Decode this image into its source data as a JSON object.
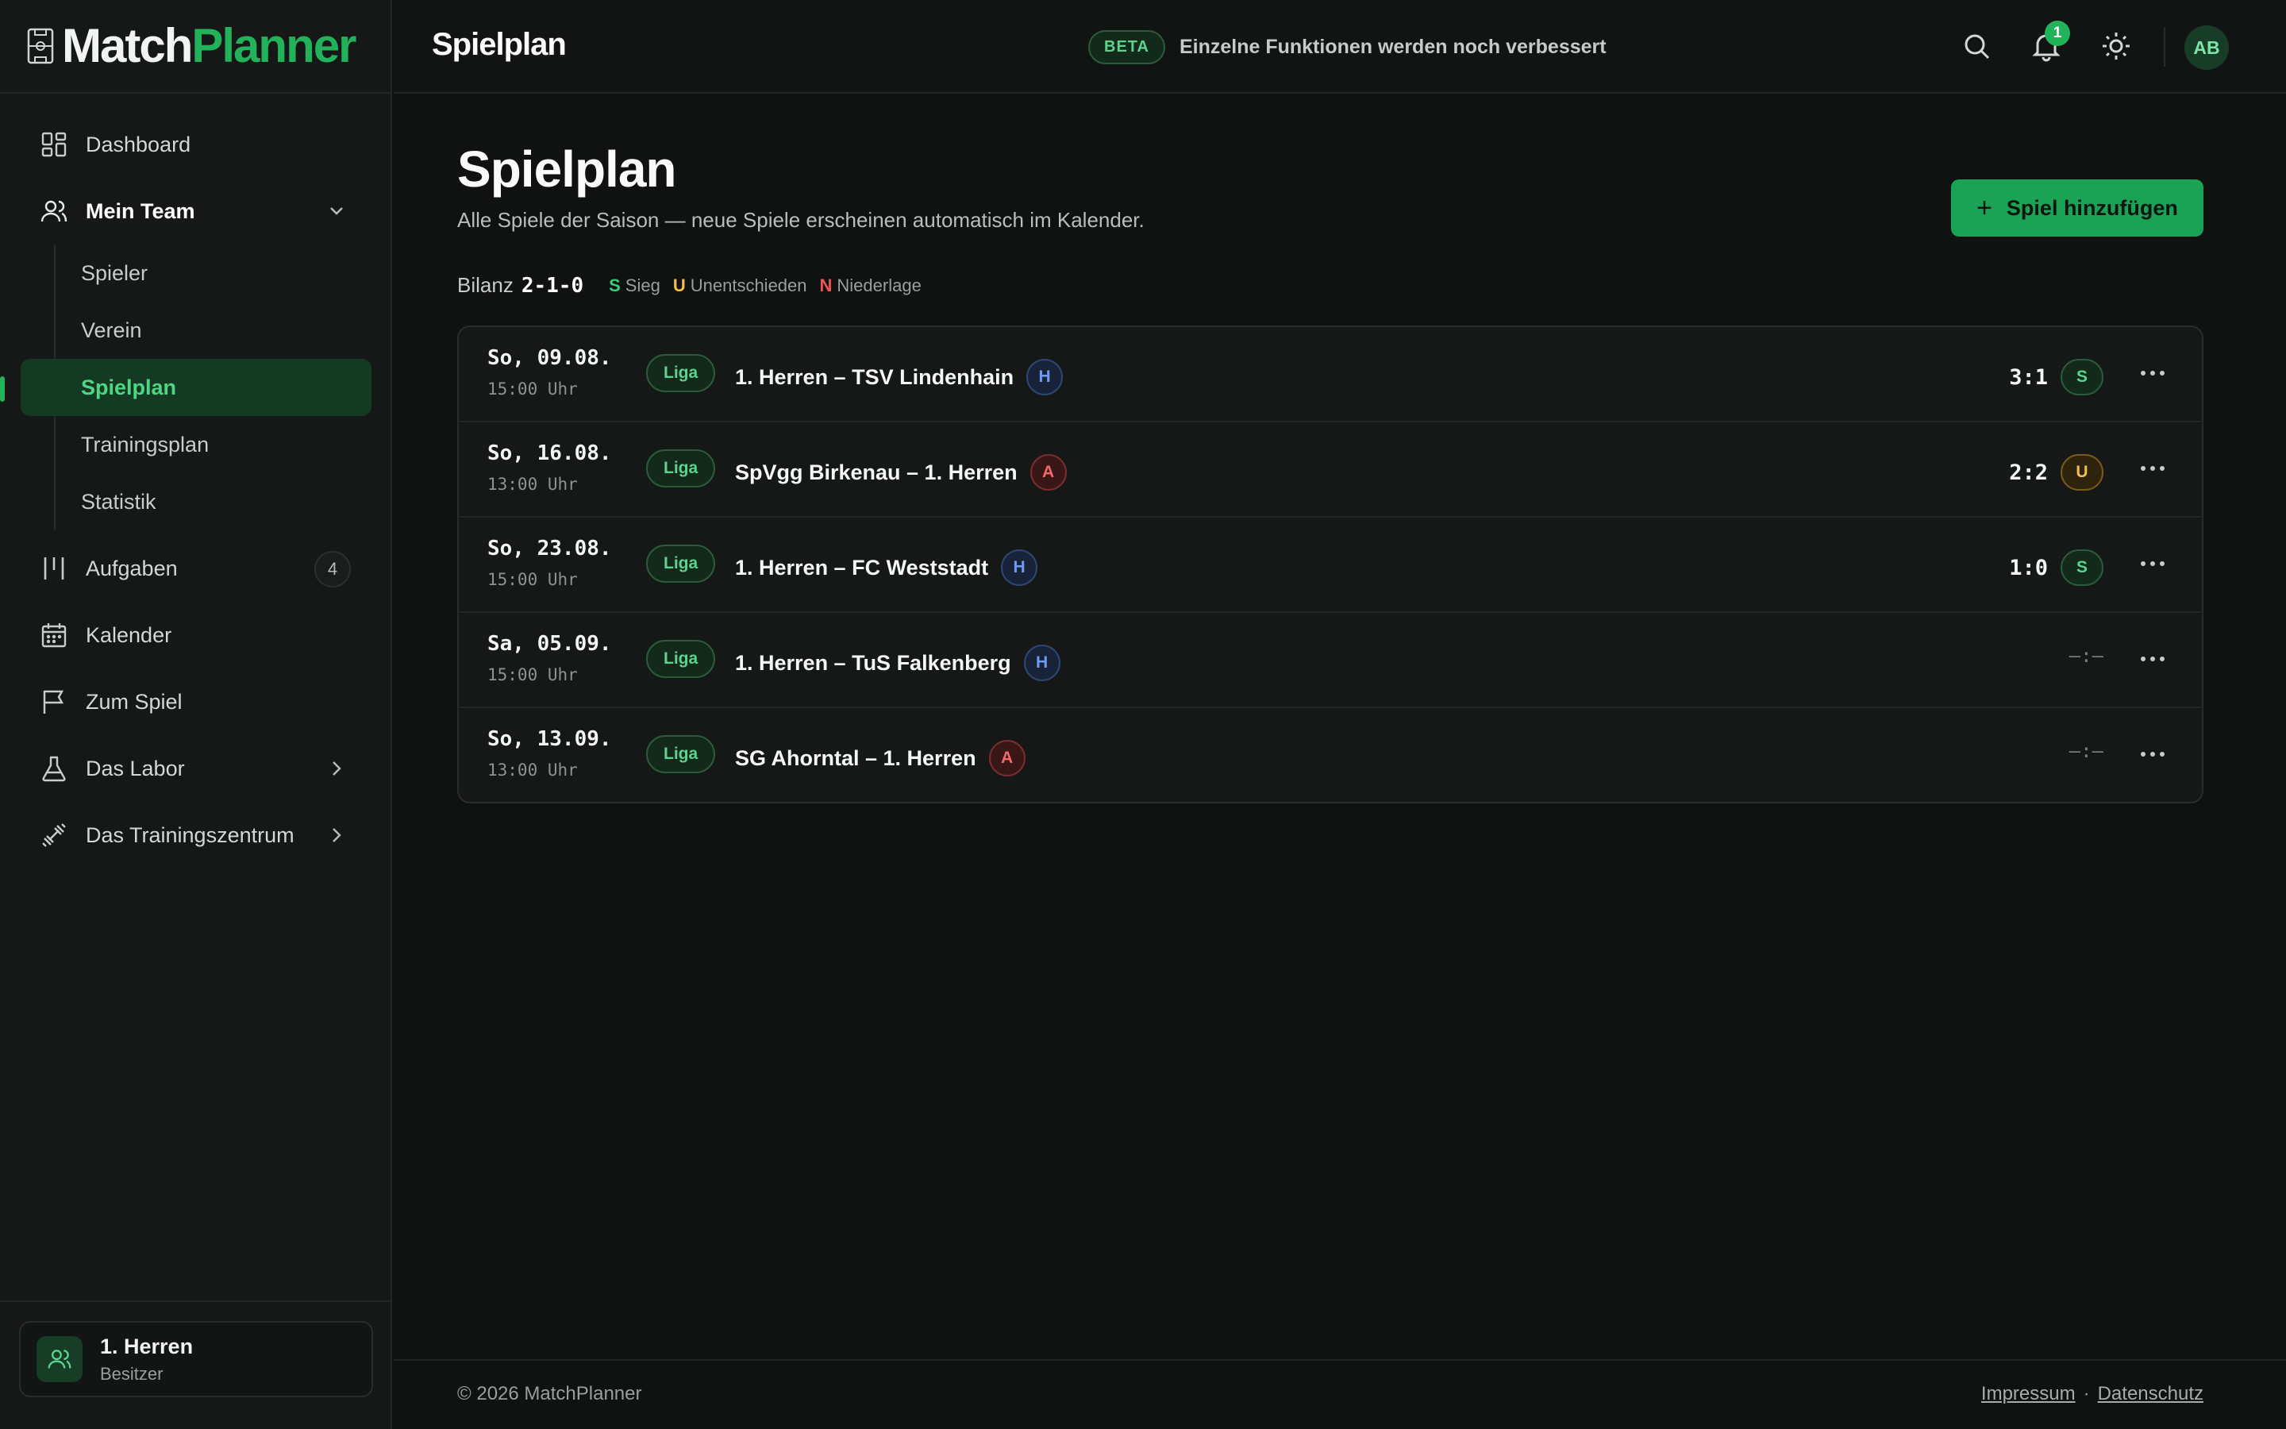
{
  "brand": {
    "part1": "Match",
    "part2": "Planner"
  },
  "sidebar": {
    "items": [
      {
        "label": "Dashboard"
      },
      {
        "label": "Mein Team"
      },
      {
        "label": "Aufgaben",
        "badge": "4"
      },
      {
        "label": "Kalender"
      },
      {
        "label": "Zum Spiel"
      },
      {
        "label": "Das Labor"
      },
      {
        "label": "Das Trainingszentrum"
      }
    ],
    "sub_items": [
      {
        "label": "Spieler"
      },
      {
        "label": "Verein"
      },
      {
        "label": "Spielplan"
      },
      {
        "label": "Trainingsplan"
      },
      {
        "label": "Statistik"
      }
    ],
    "team": {
      "name": "1. Herren",
      "role": "Besitzer"
    }
  },
  "topbar": {
    "title": "Spielplan",
    "beta_label": "BETA",
    "beta_text": "Einzelne Funktionen werden noch verbessert",
    "notification_count": "1",
    "avatar_initials": "AB"
  },
  "main": {
    "title": "Spielplan",
    "subtitle": "Alle Spiele der Saison — neue Spiele erscheinen automatisch im Kalender.",
    "add_button": "Spiel hinzufügen",
    "bilanz_label": "Bilanz",
    "bilanz_value": "2-1-0",
    "legend": [
      {
        "key": "S",
        "label": "Sieg",
        "color": "#3fc978"
      },
      {
        "key": "U",
        "label": "Unentschieden",
        "color": "#f0bf4c"
      },
      {
        "key": "N",
        "label": "Niederlage",
        "color": "#f05252"
      }
    ],
    "matches": [
      {
        "date": "So, 09.08.",
        "time": "15:00 Uhr",
        "competition": "Liga",
        "title": "1. Herren – TSV Lindenhain",
        "venue": "H",
        "score": "3:1",
        "result": "S"
      },
      {
        "date": "So, 16.08.",
        "time": "13:00 Uhr",
        "competition": "Liga",
        "title": "SpVgg Birkenau – 1. Herren",
        "venue": "A",
        "score": "2:2",
        "result": "U"
      },
      {
        "date": "So, 23.08.",
        "time": "15:00 Uhr",
        "competition": "Liga",
        "title": "1. Herren – FC Weststadt",
        "venue": "H",
        "score": "1:0",
        "result": "S"
      },
      {
        "date": "Sa, 05.09.",
        "time": "15:00 Uhr",
        "competition": "Liga",
        "title": "1. Herren – TuS Falkenberg",
        "venue": "H",
        "score": "–:–",
        "result": ""
      },
      {
        "date": "So, 13.09.",
        "time": "13:00 Uhr",
        "competition": "Liga",
        "title": "SG Ahorntal – 1. Herren",
        "venue": "A",
        "score": "–:–",
        "result": ""
      }
    ]
  },
  "footer": {
    "copyright": "© 2026 MatchPlanner",
    "impressum": "Impressum",
    "separator": "·",
    "datenschutz": "Datenschutz"
  }
}
